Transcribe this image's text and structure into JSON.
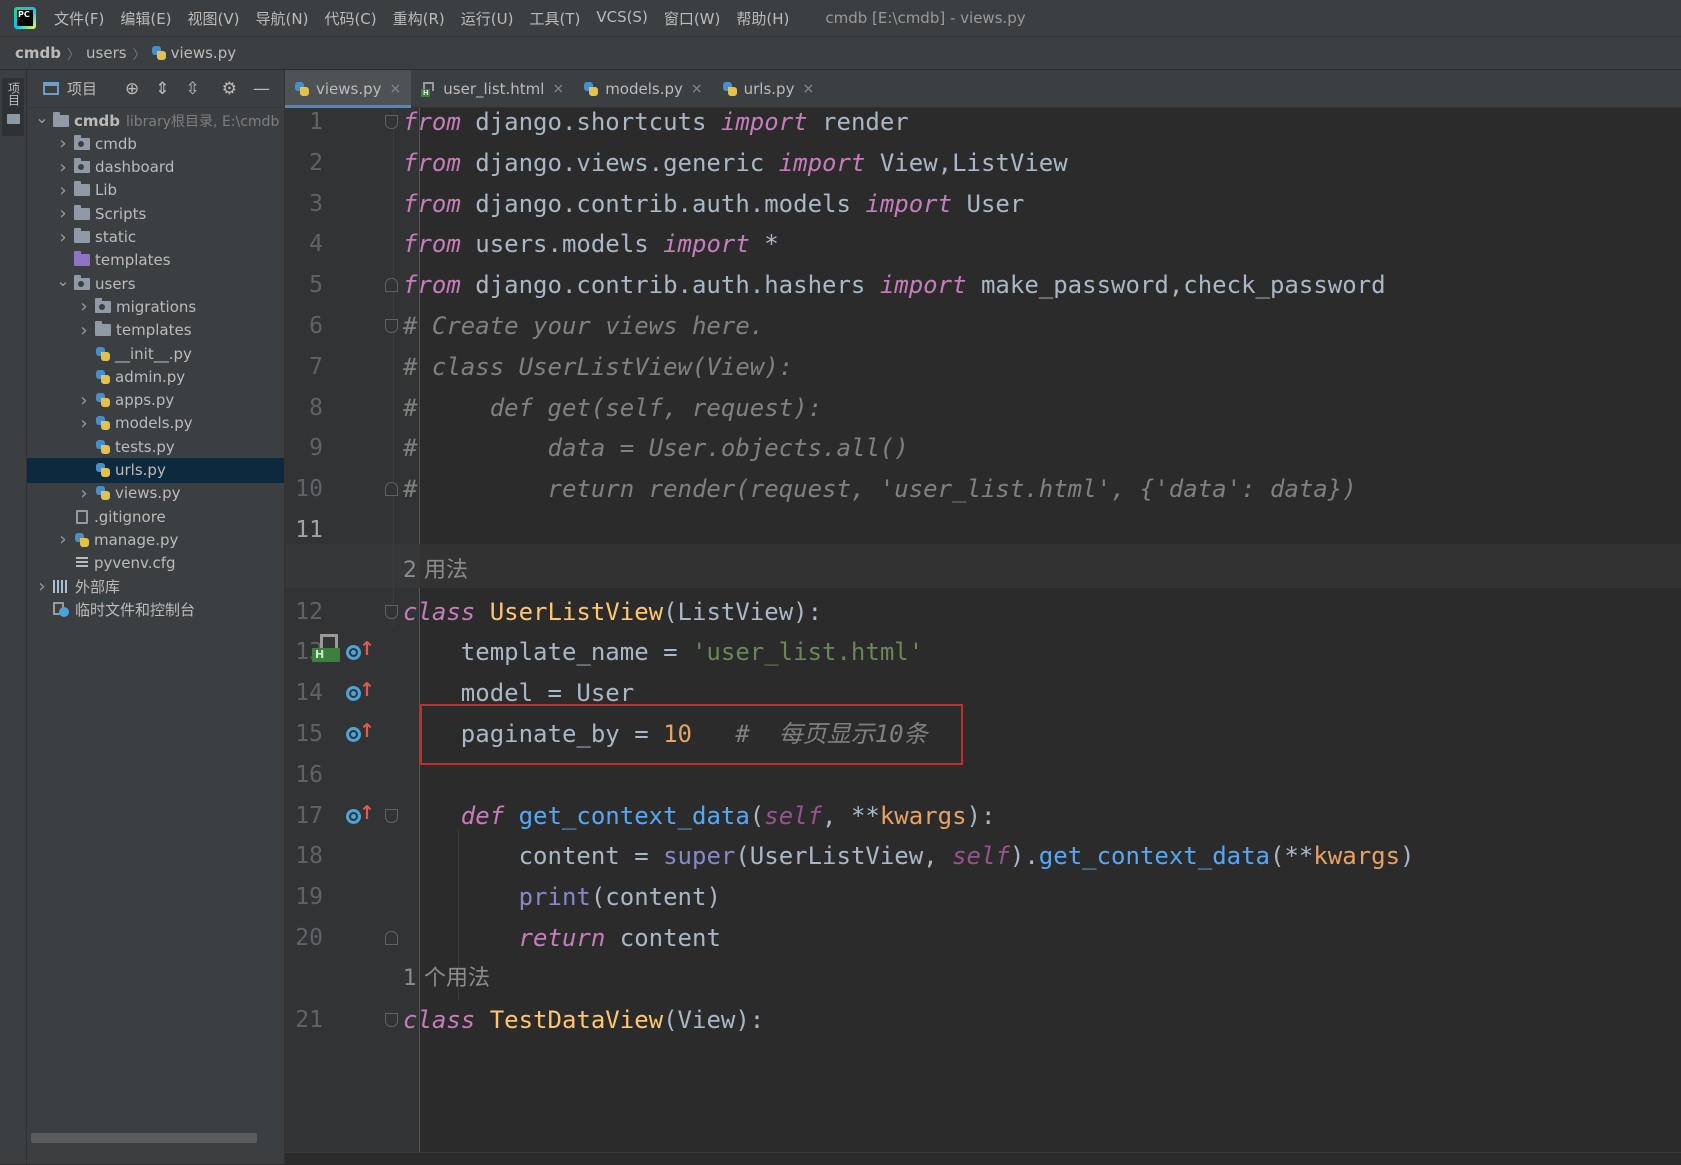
{
  "menubar": {
    "logo_text": "PC",
    "items": [
      "文件(F)",
      "编辑(E)",
      "视图(V)",
      "导航(N)",
      "代码(C)",
      "重构(R)",
      "运行(U)",
      "工具(T)",
      "VCS(S)",
      "窗口(W)",
      "帮助(H)"
    ],
    "window_title": "cmdb [E:\\cmdb] - views.py"
  },
  "breadcrumb": [
    "cmdb",
    "users",
    "views.py"
  ],
  "left_stripe": {
    "project_label": "项目"
  },
  "project_panel": {
    "title": "项目",
    "tree": [
      {
        "label": "cmdb",
        "hint": "library根目录,  E:\\cmdb",
        "icon": "folder",
        "chevron": "down",
        "depth": 0,
        "bold": true
      },
      {
        "label": "cmdb",
        "icon": "module-folder",
        "chevron": "right",
        "depth": 1
      },
      {
        "label": "dashboard",
        "icon": "module-folder",
        "chevron": "right",
        "depth": 1
      },
      {
        "label": "Lib",
        "icon": "folder",
        "chevron": "right",
        "depth": 1
      },
      {
        "label": "Scripts",
        "icon": "folder",
        "chevron": "right",
        "depth": 1
      },
      {
        "label": "static",
        "icon": "folder",
        "chevron": "right",
        "depth": 1
      },
      {
        "label": "templates",
        "icon": "templates-folder",
        "chevron": "none",
        "depth": 1
      },
      {
        "label": "users",
        "icon": "module-folder",
        "chevron": "down",
        "depth": 1
      },
      {
        "label": "migrations",
        "icon": "module-folder",
        "chevron": "right",
        "depth": 2
      },
      {
        "label": "templates",
        "icon": "folder",
        "chevron": "right",
        "depth": 2
      },
      {
        "label": "__init__.py",
        "icon": "python-file",
        "chevron": "none",
        "depth": 2
      },
      {
        "label": "admin.py",
        "icon": "python-file",
        "chevron": "none",
        "depth": 2
      },
      {
        "label": "apps.py",
        "icon": "python-file",
        "chevron": "right",
        "depth": 2
      },
      {
        "label": "models.py",
        "icon": "python-file",
        "chevron": "right",
        "depth": 2
      },
      {
        "label": "tests.py",
        "icon": "python-file",
        "chevron": "none",
        "depth": 2
      },
      {
        "label": "urls.py",
        "icon": "python-file",
        "chevron": "none",
        "depth": 2,
        "selected": true
      },
      {
        "label": "views.py",
        "icon": "python-file",
        "chevron": "right",
        "depth": 2
      },
      {
        "label": ".gitignore",
        "icon": "text-file",
        "chevron": "none",
        "depth": 1
      },
      {
        "label": "manage.py",
        "icon": "python-file",
        "chevron": "right",
        "depth": 1
      },
      {
        "label": "pyvenv.cfg",
        "icon": "config-file",
        "chevron": "none",
        "depth": 1
      },
      {
        "label": "外部库",
        "icon": "library",
        "chevron": "right",
        "depth": 0
      },
      {
        "label": "临时文件和控制台",
        "icon": "scratch",
        "chevron": "none",
        "depth": 0
      }
    ]
  },
  "tabs": [
    {
      "label": "views.py",
      "icon": "python-file",
      "active": true
    },
    {
      "label": "user_list.html",
      "icon": "html-file"
    },
    {
      "label": "models.py",
      "icon": "python-file"
    },
    {
      "label": "urls.py",
      "icon": "python-file"
    }
  ],
  "editor": {
    "current_line": 11,
    "lines": [
      {
        "n": "1",
        "tokens": [
          [
            "kwi",
            "from"
          ],
          [
            "plain",
            " django.shortcuts "
          ],
          [
            "kwi",
            "import"
          ],
          [
            "plain",
            " render"
          ]
        ],
        "fold": "start"
      },
      {
        "n": "2",
        "tokens": [
          [
            "kwi",
            "from"
          ],
          [
            "plain",
            " django.views.generic "
          ],
          [
            "kwi",
            "import"
          ],
          [
            "plain",
            " View,ListView"
          ]
        ]
      },
      {
        "n": "3",
        "tokens": [
          [
            "kwi",
            "from"
          ],
          [
            "plain",
            " django.contrib.auth.models "
          ],
          [
            "kwi",
            "import"
          ],
          [
            "plain",
            " User"
          ]
        ]
      },
      {
        "n": "4",
        "tokens": [
          [
            "kwi",
            "from"
          ],
          [
            "plain",
            " users.models "
          ],
          [
            "kwi",
            "import"
          ],
          [
            "plain",
            " *"
          ]
        ]
      },
      {
        "n": "5",
        "tokens": [
          [
            "kwi",
            "from"
          ],
          [
            "plain",
            " django.contrib.auth.hashers "
          ],
          [
            "kwi",
            "import"
          ],
          [
            "plain",
            " make_password,check_password"
          ]
        ],
        "fold": "end"
      },
      {
        "n": "6",
        "tokens": [
          [
            "cmt",
            "# Create your views here."
          ]
        ],
        "fold": "start"
      },
      {
        "n": "7",
        "tokens": [
          [
            "cmt",
            "# class UserListView(View):"
          ]
        ]
      },
      {
        "n": "8",
        "tokens": [
          [
            "cmt",
            "#     def get(self, request):"
          ]
        ]
      },
      {
        "n": "9",
        "tokens": [
          [
            "cmt",
            "#         data = User.objects.all()"
          ]
        ]
      },
      {
        "n": "10",
        "tokens": [
          [
            "cmt",
            "#         return render(request, 'user_list.html', {'data': data})"
          ]
        ],
        "fold": "end"
      },
      {
        "n": "11",
        "tokens": []
      },
      {
        "inlay": "2 用法"
      },
      {
        "n": "12",
        "tokens": [
          [
            "kwi",
            "class"
          ],
          [
            "plain",
            " "
          ],
          [
            "cls",
            "UserListView"
          ],
          [
            "plain",
            "(ListView):"
          ]
        ],
        "fold": "start"
      },
      {
        "n": "13",
        "tokens": [
          [
            "plain",
            "    template_name = "
          ],
          [
            "str",
            "'user_list.html'"
          ]
        ],
        "gutter": [
          "html",
          "override"
        ]
      },
      {
        "n": "14",
        "tokens": [
          [
            "plain",
            "    model = User"
          ]
        ],
        "gutter": [
          "override"
        ]
      },
      {
        "n": "15",
        "tokens": [
          [
            "plain",
            "    paginate_by = "
          ],
          [
            "num2",
            "10"
          ],
          [
            "plain",
            "   "
          ],
          [
            "cmt",
            "#  每页显示10条"
          ]
        ],
        "gutter": [
          "override"
        ]
      },
      {
        "n": "16",
        "tokens": []
      },
      {
        "n": "17",
        "tokens": [
          [
            "plain",
            "    "
          ],
          [
            "kwi",
            "def"
          ],
          [
            "plain",
            " "
          ],
          [
            "fn",
            "get_context_data"
          ],
          [
            "plain",
            "("
          ],
          [
            "self",
            "self"
          ],
          [
            "plain",
            ", **"
          ],
          [
            "kwarg",
            "kwargs"
          ],
          [
            "plain",
            "):"
          ]
        ],
        "gutter": [
          "override"
        ],
        "fold": "start"
      },
      {
        "n": "18",
        "tokens": [
          [
            "plain",
            "        content = "
          ],
          [
            "bi",
            "super"
          ],
          [
            "plain",
            "(UserListView, "
          ],
          [
            "self",
            "self"
          ],
          [
            "plain",
            ")."
          ],
          [
            "fn",
            "get_context_data"
          ],
          [
            "plain",
            "(**"
          ],
          [
            "kwarg",
            "kwargs"
          ],
          [
            "plain",
            ")"
          ]
        ]
      },
      {
        "n": "19",
        "tokens": [
          [
            "plain",
            "        "
          ],
          [
            "bi",
            "print"
          ],
          [
            "plain",
            "(content)"
          ]
        ]
      },
      {
        "n": "20",
        "tokens": [
          [
            "plain",
            "        "
          ],
          [
            "kwi",
            "return"
          ],
          [
            "plain",
            " content"
          ]
        ],
        "fold": "end"
      },
      {
        "inlay": "1 个用法"
      },
      {
        "n": "21",
        "tokens": [
          [
            "kwi",
            "class"
          ],
          [
            "plain",
            " "
          ],
          [
            "cls",
            "TestDataView"
          ],
          [
            "plain",
            "(View):"
          ]
        ],
        "fold": "start"
      }
    ]
  }
}
